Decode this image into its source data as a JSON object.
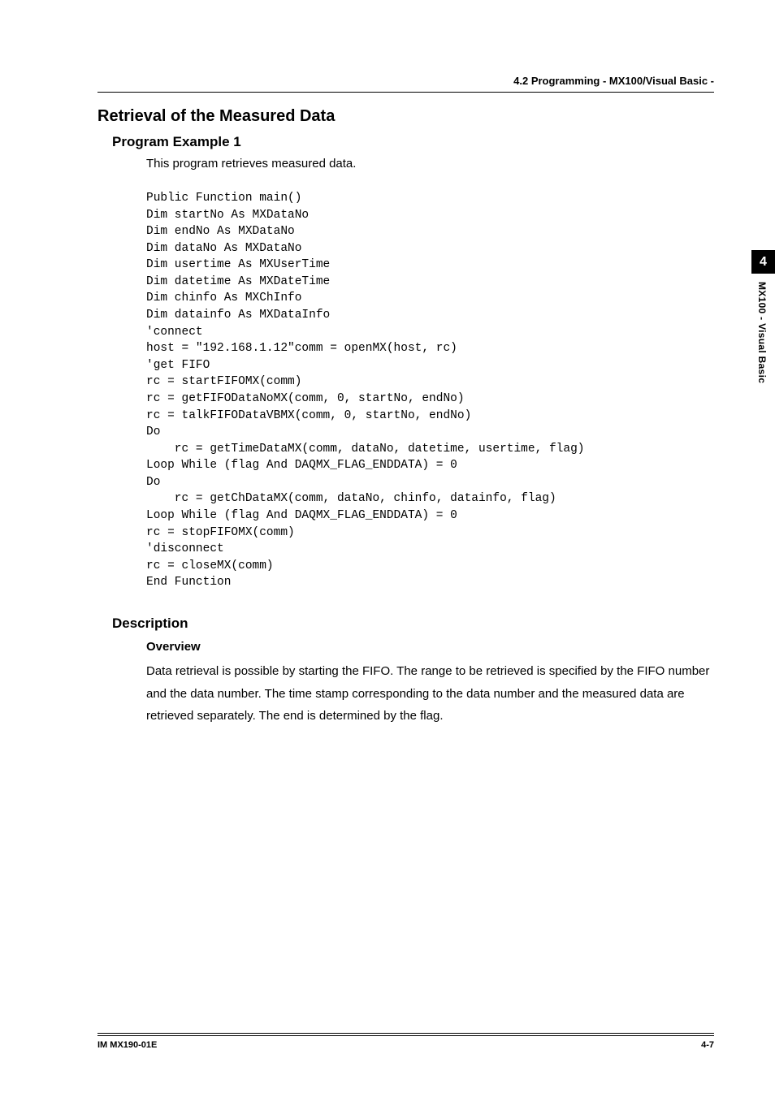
{
  "header": {
    "section_ref": "4.2  Programming - MX100/Visual Basic -"
  },
  "main": {
    "title": "Retrieval of the Measured Data",
    "subtitle": "Program Example 1",
    "intro": "This program retrieves measured data.",
    "code": "Public Function main()\nDim startNo As MXDataNo\nDim endNo As MXDataNo\nDim dataNo As MXDataNo\nDim usertime As MXUserTime\nDim datetime As MXDateTime\nDim chinfo As MXChInfo\nDim datainfo As MXDataInfo\n'connect\nhost = \"192.168.1.12\"comm = openMX(host, rc)\n'get FIFO\nrc = startFIFOMX(comm)\nrc = getFIFODataNoMX(comm, 0, startNo, endNo)\nrc = talkFIFODataVBMX(comm, 0, startNo, endNo)\nDo\n    rc = getTimeDataMX(comm, dataNo, datetime, usertime, flag)\nLoop While (flag And DAQMX_FLAG_ENDDATA) = 0\nDo\n    rc = getChDataMX(comm, dataNo, chinfo, datainfo, flag)\nLoop While (flag And DAQMX_FLAG_ENDDATA) = 0\nrc = stopFIFOMX(comm)\n'disconnect\nrc = closeMX(comm)\nEnd Function",
    "description_label": "Description",
    "overview_label": "Overview",
    "overview_text": "Data retrieval is possible by starting the FIFO. The range to be retrieved is specified by the FIFO number and the data number. The time stamp corresponding to the data number and the measured data are retrieved separately. The end is determined by the flag."
  },
  "sidebar": {
    "chapter_number": "4",
    "chapter_label": "MX100 - Visual Basic"
  },
  "footer": {
    "left": "IM MX190-01E",
    "right": "4-7"
  }
}
